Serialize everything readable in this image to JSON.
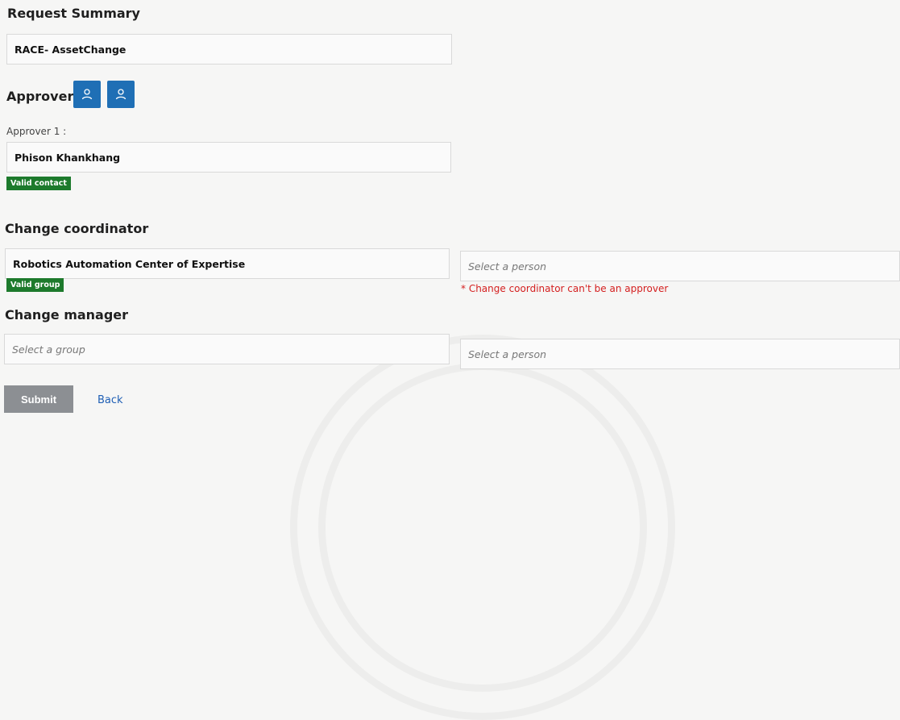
{
  "request_summary": {
    "title": "Request Summary",
    "value": "RACE- AssetChange"
  },
  "approver": {
    "title": "Approver",
    "icons": [
      "user-icon",
      "user-icon"
    ],
    "approver1_label": "Approver 1 :",
    "approver1_value": "Phison Khankhang",
    "badge": "Valid contact"
  },
  "change_coordinator": {
    "title": "Change coordinator",
    "group_value": "Robotics Automation Center of Expertise",
    "badge": "Valid group",
    "person_placeholder": "Select a person",
    "error": "* Change coordinator can't be an approver"
  },
  "change_manager": {
    "title": "Change manager",
    "group_placeholder": "Select a group",
    "person_placeholder": "Select a person"
  },
  "actions": {
    "submit": "Submit",
    "back": "Back"
  },
  "colors": {
    "accent": "#1f6fb5",
    "valid": "#1d7a2c",
    "error": "#d42020",
    "submit": "#8c8f93"
  }
}
